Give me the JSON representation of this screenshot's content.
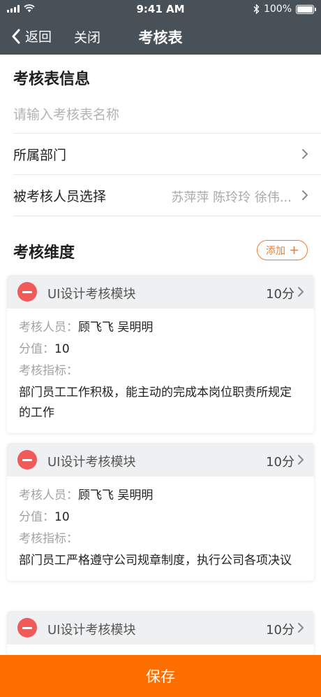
{
  "status_bar": {
    "time": "9:41 AM",
    "battery": "100%"
  },
  "nav": {
    "back_label": "返回",
    "close_label": "关闭",
    "title": "考核表"
  },
  "info": {
    "title": "考核表信息",
    "name_placeholder": "请输入考核表名称",
    "dept_label": "所属部门",
    "people_label": "被考核人员选择",
    "people_value": "苏萍萍 陈玲玲 徐伟..."
  },
  "dimensions": {
    "title": "考核维度",
    "add_label": "添加",
    "cards": [
      {
        "title": "UI设计考核模块",
        "score": "10分",
        "assessor_key": "考核人员：",
        "assessor_value": "顾飞飞 吴明明",
        "points_key": "分值：",
        "points_value": "10",
        "indicator_key": "考核指标：",
        "indicator_value": "部门员工工作积极，能主动的完成本岗位职责所规定的工作"
      },
      {
        "title": "UI设计考核模块",
        "score": "10分",
        "assessor_key": "考核人员：",
        "assessor_value": "顾飞飞 吴明明",
        "points_key": "分值：",
        "points_value": "10",
        "indicator_key": "考核指标：",
        "indicator_value": "部门员工严格遵守公司规章制度，执行公司各项决议"
      },
      {
        "title": "UI设计考核模块",
        "score": "10分"
      }
    ]
  },
  "save_label": "保存",
  "colors": {
    "header": "#495158",
    "accent": "#ff6f00",
    "remove": "#f25a5a"
  },
  "icons": [
    "signal-icon",
    "wifi-icon",
    "bluetooth-icon",
    "battery-icon",
    "back-chevron-icon",
    "chevron-right-icon",
    "plus-icon",
    "remove-circle-icon"
  ]
}
